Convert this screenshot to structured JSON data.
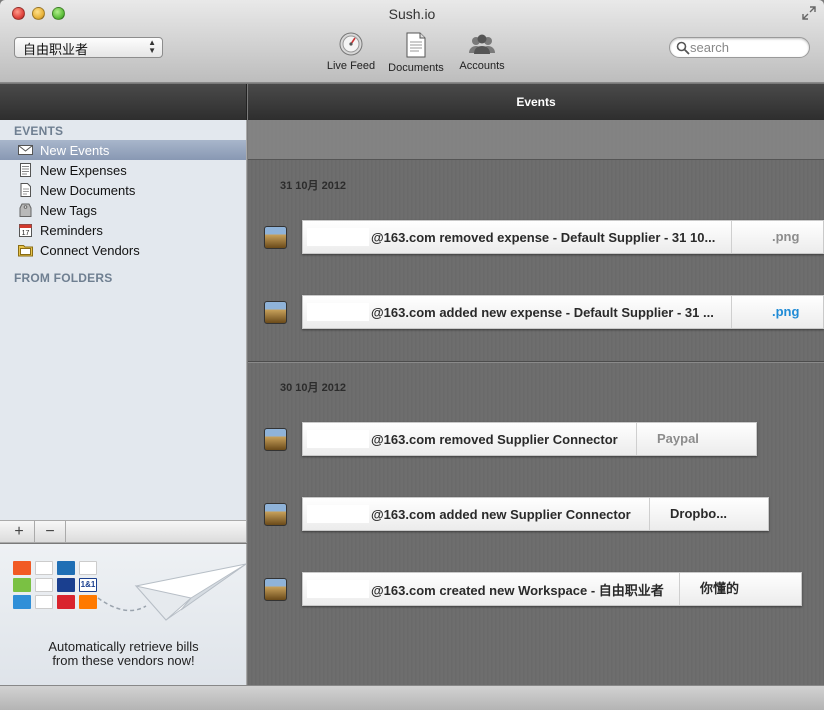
{
  "window": {
    "title": "Sush.io"
  },
  "workspace_select": {
    "value": "自由职业者"
  },
  "toolbar": {
    "items": [
      {
        "label": "Live Feed",
        "icon": "live-feed-icon"
      },
      {
        "label": "Documents",
        "icon": "document-icon"
      },
      {
        "label": "Accounts",
        "icon": "accounts-icon"
      }
    ]
  },
  "search": {
    "placeholder": "search"
  },
  "sidebar": {
    "events_heading": "EVENTS",
    "items": [
      {
        "label": "New Events",
        "icon": "envelope-icon",
        "selected": true
      },
      {
        "label": "New Expenses",
        "icon": "receipt-icon"
      },
      {
        "label": "New Documents",
        "icon": "document-icon"
      },
      {
        "label": "New Tags",
        "icon": "tag-icon"
      },
      {
        "label": "Reminders",
        "icon": "calendar-icon",
        "day": "17"
      },
      {
        "label": "Connect Vendors",
        "icon": "folder-icon"
      }
    ],
    "folders_heading": "FROM FOLDERS",
    "add_label": "+",
    "remove_label": "−"
  },
  "promo": {
    "text_line1": "Automatically retrieve bills",
    "text_line2": "from these vendors now!",
    "logo_colors": [
      "#f15a24",
      "#ffffff",
      "#1f6fb5",
      "#ffffff",
      "#7ac143",
      "#ffffff",
      "#1a3f8f",
      "#ffffff",
      "#2f8fd8",
      "#ffffff",
      "#d9232d",
      "#ff7900"
    ],
    "logo_text": "1&1"
  },
  "main": {
    "header": "Events",
    "days": [
      {
        "date": "31 10月 2012",
        "events": [
          {
            "message": "@163.com removed expense - Default Supplier - 31 10...",
            "detail": ".png",
            "detail_style": "grey"
          },
          {
            "message": "@163.com added new expense - Default Supplier - 31 ...",
            "detail": ".png",
            "detail_style": "link"
          }
        ]
      },
      {
        "date": "30 10月 2012",
        "events": [
          {
            "message": "@163.com removed Supplier Connector",
            "detail": "Paypal",
            "detail_style": "grey"
          },
          {
            "message": "@163.com added new Supplier Connector",
            "detail": "Dropbo...",
            "detail_style": "dark"
          },
          {
            "message": "@163.com created new Workspace - 自由职业者",
            "detail": "你懂的",
            "detail_style": "dark"
          }
        ]
      }
    ]
  }
}
